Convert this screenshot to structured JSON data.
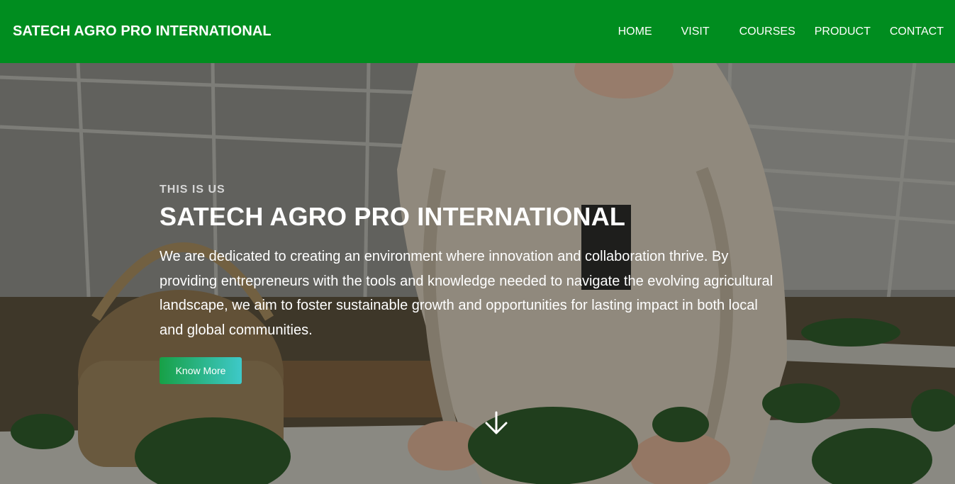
{
  "nav": {
    "brand": "SATECH AGRO PRO INTERNATIONAL",
    "links": [
      "HOME",
      "VISIT",
      "COURSES",
      "PRODUCT",
      "CONTACT"
    ],
    "background": "#008d1f"
  },
  "hero": {
    "eyebrow": "THIS IS US",
    "title": "SATECH AGRO PRO INTERNATIONAL",
    "description": "We are dedicated to creating an environment where innovation and collaboration thrive. By providing entrepreneurs with the tools and knowledge needed to navigate the evolving agricultural landscape, we aim to foster sustainable growth and opportunities for lasting impact in both local and global communities.",
    "button_label": "Know More",
    "button_gradient": [
      "#17a046",
      "#3ec9c9"
    ],
    "scroll_icon": "arrow-down-icon"
  }
}
